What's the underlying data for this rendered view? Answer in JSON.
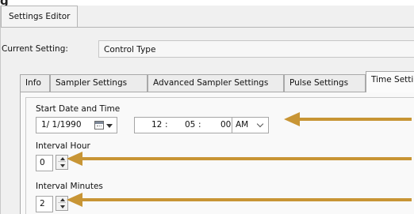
{
  "heading_fragment": "g",
  "window": {
    "title_tab": "Settings Editor"
  },
  "current_setting": {
    "label": "Current Setting:",
    "value": "Control Type"
  },
  "tabs": [
    {
      "label": "Info"
    },
    {
      "label": "Sampler Settings"
    },
    {
      "label": "Advanced Sampler Settings"
    },
    {
      "label": "Pulse Settings"
    },
    {
      "label": "Time Settings"
    }
  ],
  "active_tab_index": 4,
  "time_settings": {
    "start_label": "Start Date and Time",
    "date_value": "1/ 1/1990",
    "hour": "12",
    "separator": ":",
    "minute": "05",
    "second": "00",
    "ampm": "AM",
    "interval_hour_label": "Interval Hour",
    "interval_hour_value": "0",
    "interval_minutes_label": "Interval Minutes",
    "interval_minutes_value": "2"
  },
  "annotation": {
    "arrow_color": "#c89535"
  },
  "icons": {
    "calendar": "calendar-icon",
    "dropdown": "chevron-down-icon",
    "spin_up": "spin-up-icon",
    "spin_down": "spin-down-icon"
  }
}
